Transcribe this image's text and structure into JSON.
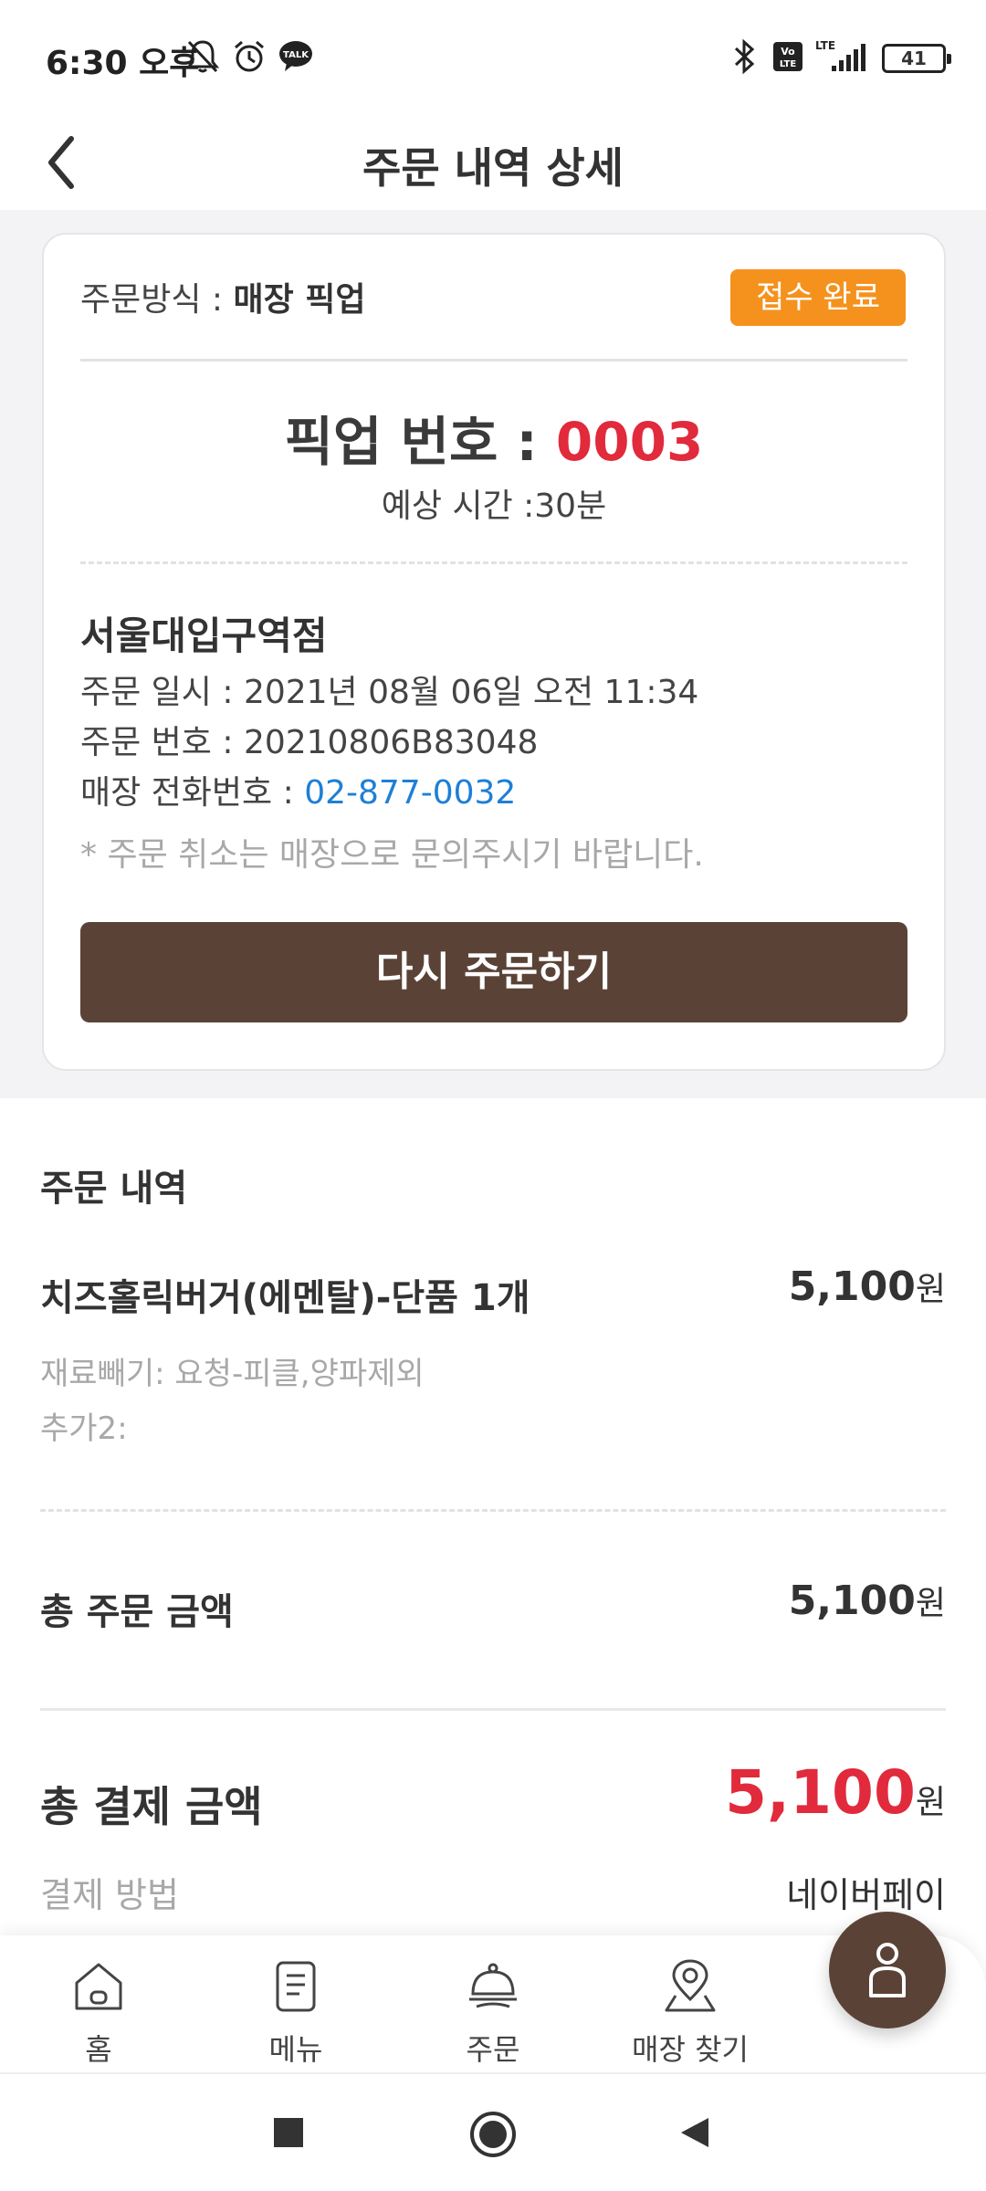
{
  "status_bar": {
    "time": "6:30 오후",
    "battery": "41",
    "icons": [
      "mute-bell-icon",
      "alarm-icon",
      "kakaotalk-icon",
      "bluetooth-icon",
      "volte-icon",
      "lte-signal-icon",
      "battery-icon"
    ],
    "talk_label": "TALK",
    "volte_label": "Vo LTE",
    "lte_label": "LTE"
  },
  "header": {
    "title": "주문 내역 상세",
    "back_icon": "back-arrow-icon"
  },
  "order_card": {
    "method_label": "주문방식 : ",
    "method_value": "매장 픽업",
    "status_badge": "접수 완료",
    "pickup_label": "픽업 번호 : ",
    "pickup_number": "0003",
    "eta": "예상 시간 :30분",
    "store_name": "서울대입구역점",
    "order_date": "주문 일시 : 2021년 08월 06일 오전 11:34",
    "order_number": "주문 번호 : 20210806B83048",
    "phone_label": "매장 전화번호 : ",
    "phone_value": "02-877-0032",
    "cancel_note": "* 주문 취소는 매장으로 문의주시기 바랍니다.",
    "reorder_button": "다시 주문하기"
  },
  "order_details": {
    "section_title": "주문 내역",
    "items": [
      {
        "name": "치즈홀릭버거(에멘탈)-단품 1개",
        "price": "5,100",
        "options": [
          "재료빼기: 요청-피클,양파제외",
          "추가2:"
        ]
      }
    ],
    "currency": "원",
    "total_label": "총 주문 금액",
    "total_value": "5,100",
    "payment_total_label": "총 결제 금액",
    "payment_total_value": "5,100",
    "payment_method_label": "결제 방법",
    "payment_method_value": "네이버페이"
  },
  "bottom_nav": {
    "items": [
      {
        "label": "홈",
        "icon": "home-icon"
      },
      {
        "label": "메뉴",
        "icon": "menu-clipboard-icon"
      },
      {
        "label": "주문",
        "icon": "order-cloche-icon"
      },
      {
        "label": "매장 찾기",
        "icon": "map-pin-icon"
      }
    ],
    "fab_icon": "user-profile-icon"
  },
  "system_nav": {
    "icons": [
      "recents-square-icon",
      "home-circle-icon",
      "back-triangle-icon"
    ]
  },
  "colors": {
    "accent_brown": "#5a4336",
    "badge_orange": "#f5921e",
    "highlight_red": "#e12a3c",
    "link_blue": "#1d7fd6"
  }
}
